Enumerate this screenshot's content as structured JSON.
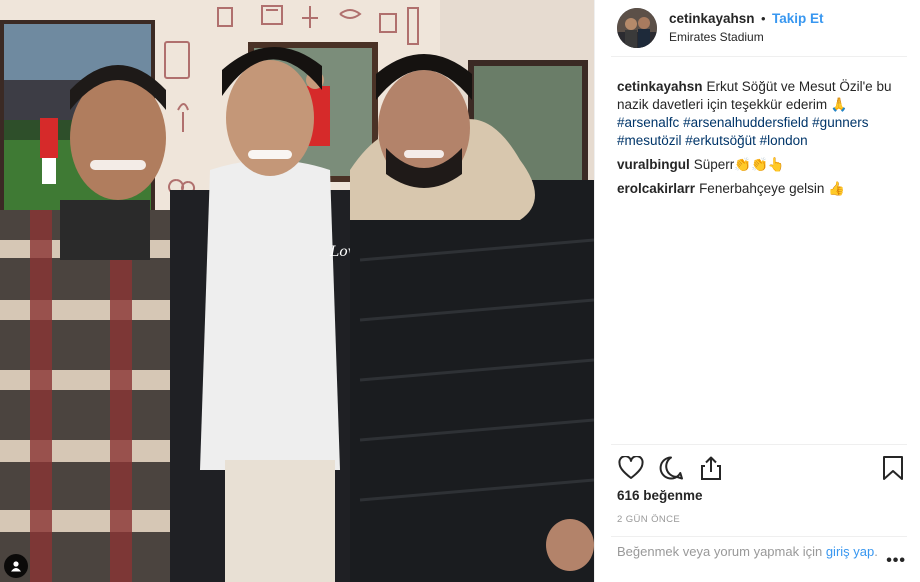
{
  "post": {
    "username": "cetinkayahsn",
    "follow_label": "Takip Et",
    "separator": "•",
    "location": "Emirates Stadium"
  },
  "caption": {
    "author": "cetinkayahsn",
    "text": "Erkut Söğüt ve Mesut Özil'e bu nazik davetleri için teşekkür ederim 🙏",
    "hashtags": [
      "#arsenalfc",
      "#arsenalhuddersfield",
      "#gunners",
      "#mesutözil",
      "#erkutsöğüt",
      "#london"
    ]
  },
  "comments": [
    {
      "author": "vuralbingul",
      "text": "Süperr👏👏👆"
    },
    {
      "author": "erolcakirlarr",
      "text": "Fenerbahçeye gelsin 👍"
    }
  ],
  "stats": {
    "likes": "616 beğenme",
    "time_ago": "2 GÜN ÖNCE"
  },
  "login": {
    "text": "Beğenmek veya yorum yapmak için",
    "link": "giriş yap",
    "suffix": "."
  },
  "icons": {
    "like": "heart-icon",
    "comment": "comment-bubble-icon",
    "share": "share-icon",
    "save": "bookmark-icon",
    "more": "more-dots-icon",
    "user_tag": "user-tag-icon"
  },
  "colors": {
    "link_blue": "#3897f0",
    "hashtag_blue": "#003569",
    "muted_gray": "#999999"
  }
}
